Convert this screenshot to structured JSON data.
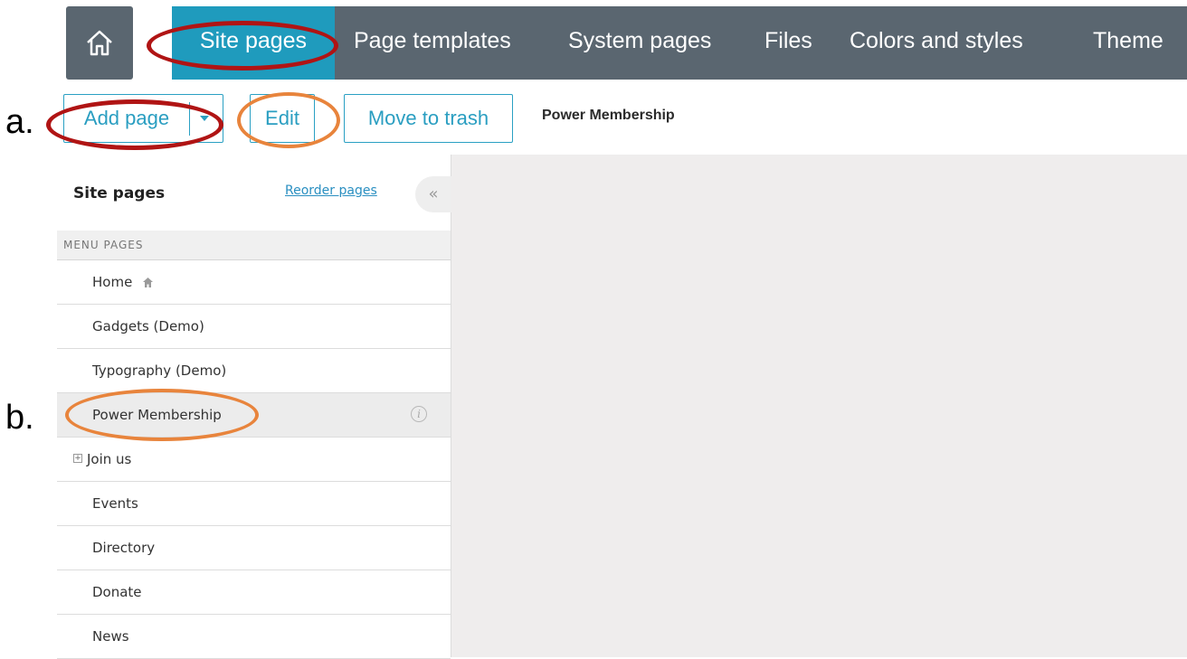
{
  "topnav": {
    "tabs": [
      {
        "label": "Site pages",
        "active": true
      },
      {
        "label": "Page templates"
      },
      {
        "label": "System pages"
      },
      {
        "label": "Files"
      },
      {
        "label": "Colors and styles"
      },
      {
        "label": "Theme"
      }
    ]
  },
  "toolbar": {
    "add_page_label": "Add page",
    "edit_label": "Edit",
    "trash_label": "Move to trash",
    "current_page": "Power Membership"
  },
  "sidebar": {
    "title": "Site pages",
    "reorder_label": "Reorder pages",
    "collapse_glyph": "«",
    "section_header": "MENU PAGES",
    "items": [
      {
        "label": "Home",
        "icon": "home-icon"
      },
      {
        "label": "Gadgets (Demo)"
      },
      {
        "label": "Typography (Demo)"
      },
      {
        "label": "Power Membership",
        "selected": true,
        "icon": "info-icon"
      },
      {
        "label": "Join us",
        "icon": "expand-icon"
      },
      {
        "label": "Events"
      },
      {
        "label": "Directory"
      },
      {
        "label": "Donate"
      },
      {
        "label": "News"
      }
    ]
  },
  "annotations": {
    "a": "a.",
    "b": "b."
  },
  "colors": {
    "nav_bg": "#5a6670",
    "active_tab": "#1f9bbd",
    "accent": "#2a9ec1",
    "red_highlight": "#b01414",
    "orange_highlight": "#e8843c"
  }
}
